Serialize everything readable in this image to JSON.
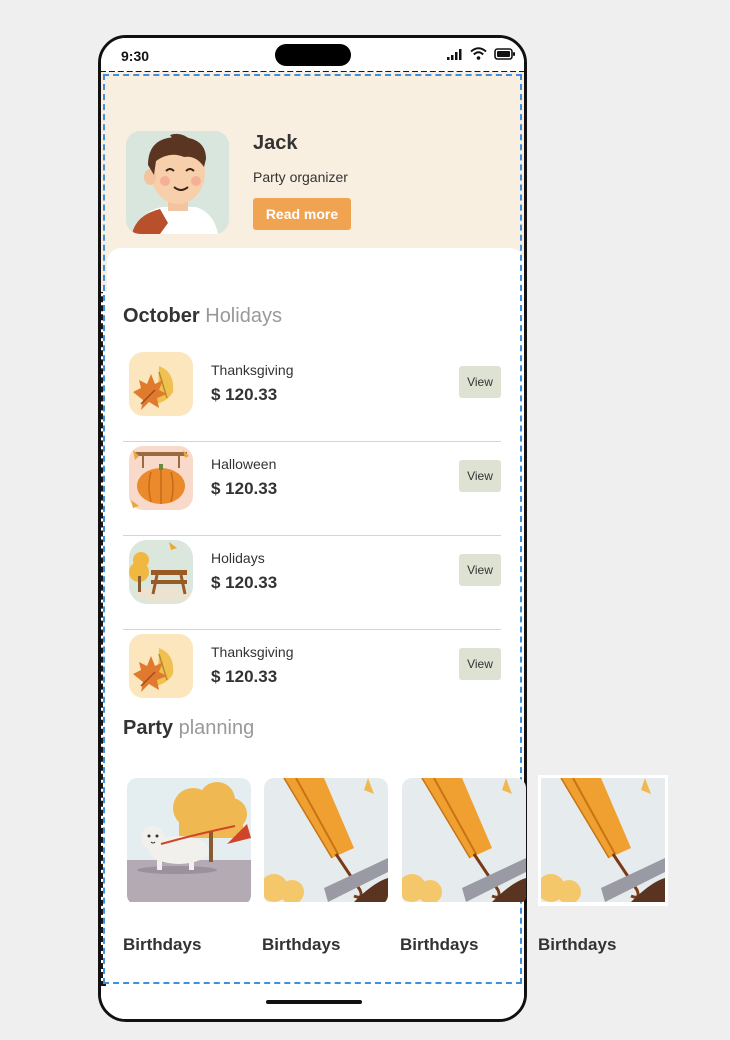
{
  "status_bar": {
    "time": "9:30"
  },
  "profile": {
    "name": "Jack",
    "role": "Party organizer",
    "read_more_label": "Read more"
  },
  "holidays_section": {
    "title_bold": "October",
    "title_rest": " Holidays"
  },
  "holidays": [
    {
      "name": "Thanksgiving",
      "price": "$ 120.33",
      "view_label": "View",
      "icon": "autumn-leaves-icon"
    },
    {
      "name": "Halloween",
      "price": "$ 120.33",
      "view_label": "View",
      "icon": "pumpkin-icon"
    },
    {
      "name": "Holidays",
      "price": "$ 120.33",
      "view_label": "View",
      "icon": "picnic-table-icon"
    },
    {
      "name": "Thanksgiving",
      "price": "$ 120.33",
      "view_label": "View",
      "icon": "autumn-leaves-icon"
    }
  ],
  "party_section": {
    "title_bold": "Party",
    "title_rest": " planning"
  },
  "party_cards": [
    {
      "label": "Birthdays",
      "image": "dog-walk-image"
    },
    {
      "label": "Birthdays",
      "image": "umbrella-image"
    },
    {
      "label": "Birthdays",
      "image": "umbrella-image"
    },
    {
      "label": "Birthdays",
      "image": "umbrella-image"
    }
  ]
}
